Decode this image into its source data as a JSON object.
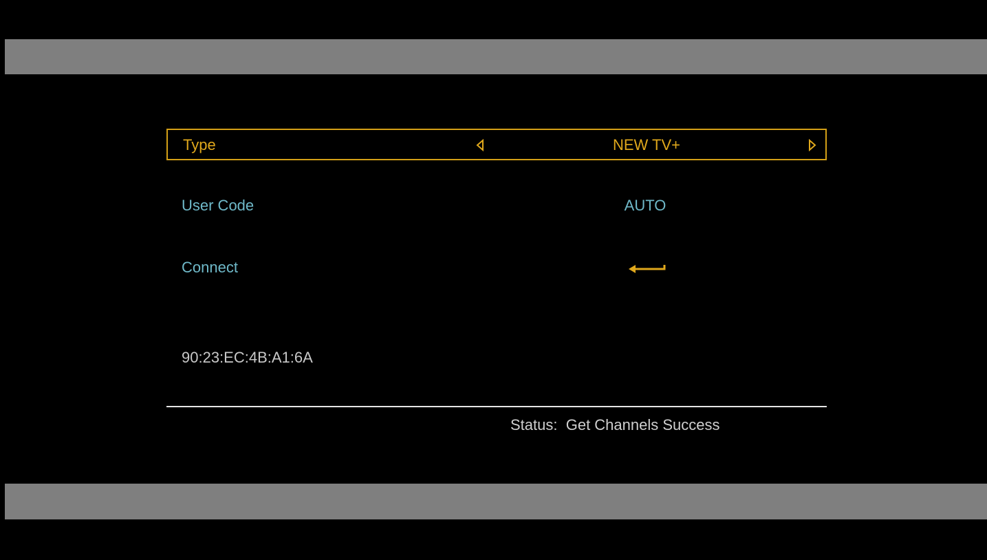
{
  "menu": {
    "type": {
      "label": "Type",
      "value": "NEW TV+"
    },
    "user_code": {
      "label": "User Code",
      "value": "AUTO"
    },
    "connect": {
      "label": "Connect",
      "icon": "enter-arrow-icon"
    }
  },
  "mac_address": "90:23:EC:4B:A1:6A",
  "status": {
    "label": "Status:",
    "value": "Get Channels Success"
  },
  "colors": {
    "accent": "#e0a81c",
    "label": "#6fb9c9",
    "bar": "#7f7f7f",
    "background": "#000000"
  }
}
